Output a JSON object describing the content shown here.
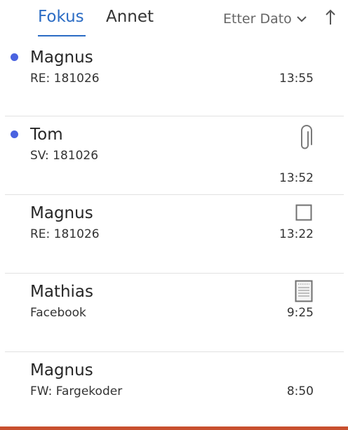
{
  "tabs": {
    "fokus_label": "Fokus",
    "annet_label": "Annet",
    "active": "Fokus"
  },
  "sort": {
    "label": "Etter Dato",
    "chevron_icon": "chevron-down-icon",
    "direction_icon": "arrow-up-icon"
  },
  "colors": {
    "accent": "#2b6cc4",
    "unread_dot": "#4a63e0",
    "bottom_bar": "#c8502f"
  },
  "messages": [
    {
      "sender": "Magnus",
      "subject": "RE: 181026",
      "time": "13:55",
      "unread": true,
      "icon": ""
    },
    {
      "sender": "Tom",
      "subject": "SV: 181026",
      "time": "13:52",
      "unread": true,
      "icon": "paperclip-icon"
    },
    {
      "sender": "Magnus",
      "subject": "RE: 181026",
      "time": "13:22",
      "unread": false,
      "icon": "flag-square-icon"
    },
    {
      "sender": "Mathias",
      "subject": "Facebook",
      "time": "9:25",
      "unread": false,
      "icon": "note-icon"
    },
    {
      "sender": "Magnus",
      "subject": "FW: Fargekoder",
      "time": "8:50",
      "unread": false,
      "icon": ""
    }
  ]
}
